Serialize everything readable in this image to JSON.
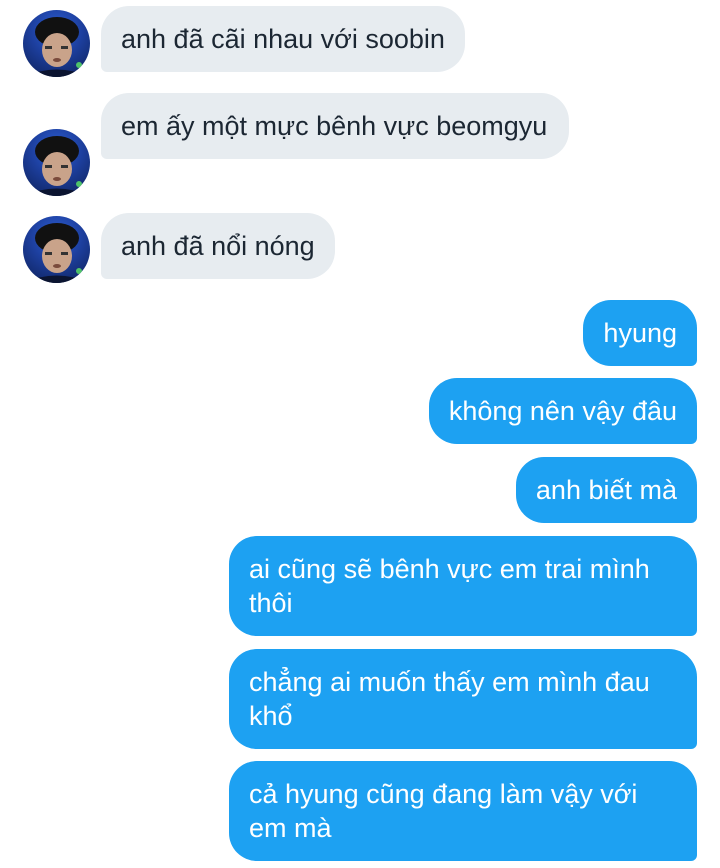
{
  "conversation": {
    "incoming": [
      {
        "text": "anh đã cãi nhau với soobin"
      },
      {
        "text": "em ấy một mực bênh vực beomgyu"
      },
      {
        "text": "anh đã nổi nóng"
      }
    ],
    "outgoing": [
      {
        "text": "hyung"
      },
      {
        "text": "không nên vậy đâu"
      },
      {
        "text": "anh biết mà"
      },
      {
        "text": "ai cũng sẽ bênh vực em trai mình thôi"
      },
      {
        "text": "chẳng ai muốn thấy em mình đau khổ"
      },
      {
        "text": "cả hyung cũng đang làm vậy với em mà"
      }
    ]
  },
  "colors": {
    "incoming_bubble": "#e7ecf0",
    "incoming_text": "#1c2733",
    "outgoing_bubble": "#1da1f2",
    "outgoing_text": "#ffffff"
  }
}
